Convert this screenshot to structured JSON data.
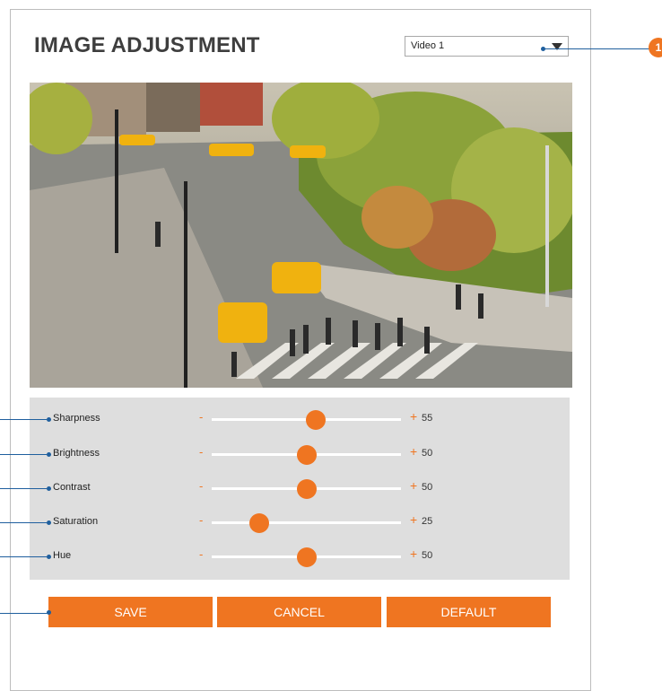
{
  "page": {
    "title": "IMAGE ADJUSTMENT"
  },
  "video_select": {
    "value": "Video 1"
  },
  "callout": {
    "label": "1"
  },
  "photo": {
    "description_icon": "street-scene-photo"
  },
  "sliders": [
    {
      "name": "sharpness",
      "label": "Sharpness",
      "minus": "-",
      "plus": "+",
      "value": "55",
      "level": 0.55
    },
    {
      "name": "brightness",
      "label": "Brightness",
      "minus": "-",
      "plus": "+",
      "value": "50",
      "level": 0.5
    },
    {
      "name": "contrast",
      "label": "Contrast",
      "minus": "-",
      "plus": "+",
      "value": "50",
      "level": 0.5
    },
    {
      "name": "saturation",
      "label": "Saturation",
      "minus": "-",
      "plus": "+",
      "value": "25",
      "level": 0.25
    },
    {
      "name": "hue",
      "label": "Hue",
      "minus": "-",
      "plus": "+",
      "value": "50",
      "level": 0.5
    }
  ],
  "buttons": {
    "save": "SAVE",
    "cancel": "CANCEL",
    "default": "DEFAULT"
  },
  "colors": {
    "accent": "#ef7521",
    "callout": "#1f5f9e",
    "panel_bg": "#dedede"
  }
}
